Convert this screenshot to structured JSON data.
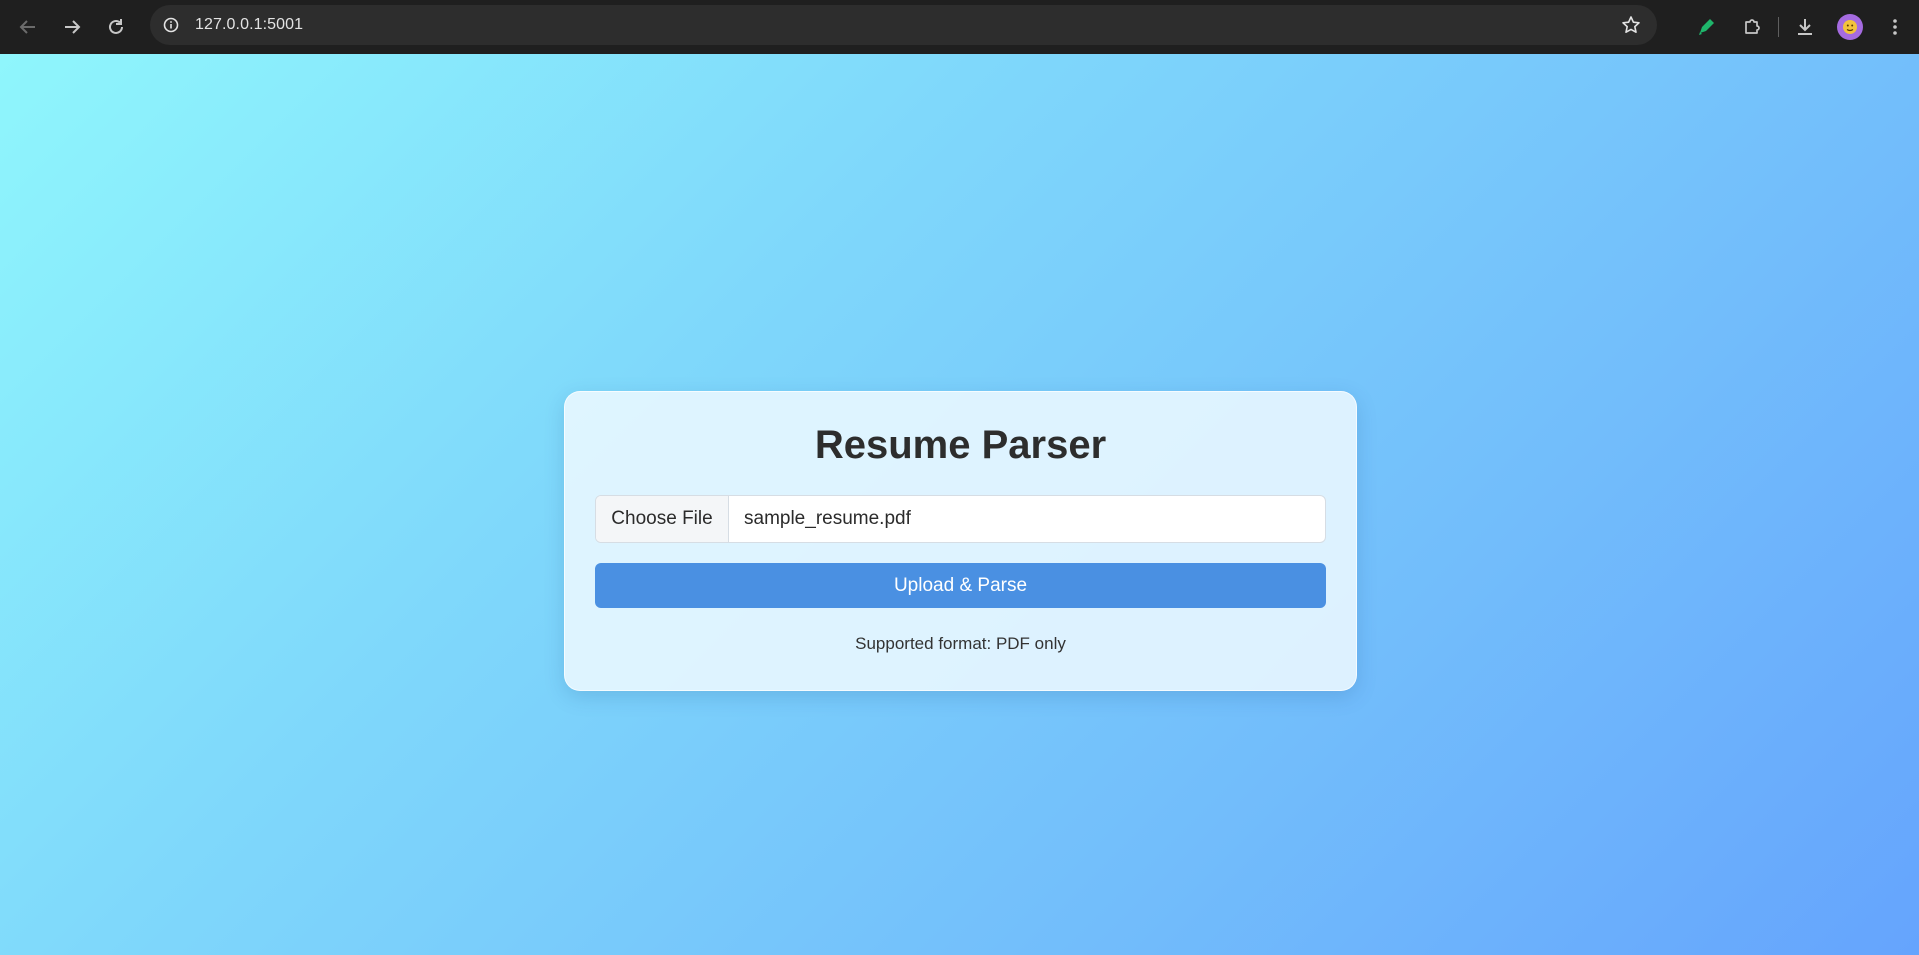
{
  "browser": {
    "url": "127.0.0.1:5001",
    "icons": {
      "back": "arrow-left-icon",
      "forward": "arrow-right-icon",
      "reload": "reload-icon",
      "site_info": "info-icon",
      "bookmark": "star-icon",
      "extension_pen": "pen-icon",
      "extensions": "puzzle-icon",
      "downloads": "download-icon",
      "menu": "kebab-menu-icon"
    }
  },
  "page": {
    "title": "Resume Parser",
    "file_input": {
      "button_label": "Choose File",
      "file_name": "sample_resume.pdf"
    },
    "upload_button_label": "Upload & Parse",
    "hint": "Supported format: PDF only"
  },
  "colors": {
    "primary_button": "#4a90e2",
    "gradient_start": "#8ff6fc",
    "gradient_end": "#65a4fd"
  }
}
